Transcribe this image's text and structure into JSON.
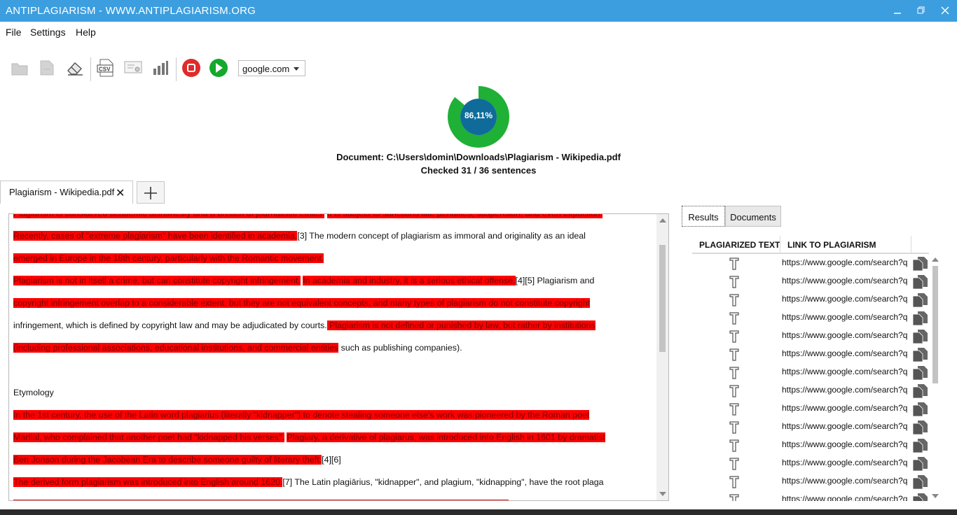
{
  "window": {
    "title": "ANTIPLAGIARISM - WWW.ANTIPLAGIARISM.ORG"
  },
  "menu": {
    "items": [
      "File",
      "Settings",
      "Help"
    ]
  },
  "toolbar": {
    "buttons": [
      "open-folder",
      "save",
      "eraser",
      "export-csv",
      "certificate",
      "statistics",
      "stop",
      "start"
    ],
    "engine_value": "google.com"
  },
  "gauge": {
    "percent_label": "86,11%",
    "value": 0.8611,
    "colors": {
      "ring": "#1fb036",
      "center": "#0f6c9a"
    }
  },
  "document": {
    "line": "Document: C:\\Users\\domin\\Downloads\\Plagiarism - Wikipedia.pdf",
    "checked": "Checked 31 / 36 sentences"
  },
  "doc_tab": {
    "label": "Plagiarism - Wikipedia.pdf"
  },
  "text_lines": [
    {
      "segments": [
        {
          "t": "Plagiarism is considered academic dishonesty and a breach of journalistic ethics.",
          "hl": true
        },
        {
          "t": " ",
          "hl": false
        },
        {
          "t": "It is subject to sanctions like penalties, suspension, and even expulsion.",
          "hl": true
        }
      ]
    },
    {
      "segments": [
        {
          "t": "Recently, cases of \"extreme plagiarism\" have been identified in academia.",
          "hl": true
        },
        {
          "t": "[3] The modern concept of plagiarism as immoral and originality as an ideal",
          "hl": false
        }
      ]
    },
    {
      "segments": [
        {
          "t": "emerged in Europe in the 18th century, particularly with the Romantic movement.",
          "hl": true
        }
      ]
    },
    {
      "segments": [
        {
          "t": "Plagiarism is not in itself a crime, but can constitute copyright infringement.",
          "hl": true
        },
        {
          "t": " ",
          "hl": false
        },
        {
          "t": "In academia and industry, it is a serious ethical offense.",
          "hl": true
        },
        {
          "t": "[4][5] Plagiarism and",
          "hl": false
        }
      ]
    },
    {
      "segments": [
        {
          "t": "copyright infringement overlap to a considerable extent, but they are not equivalent concepts, and many types of plagiarism do not constitute copyright",
          "hl": true
        }
      ]
    },
    {
      "segments": [
        {
          "t": "infringement, which is defined by copyright law and may be adjudicated by courts.",
          "hl": false
        },
        {
          "t": " Plagiarism is not defined or punished by law, but rather by institutions",
          "hl": true
        }
      ]
    },
    {
      "segments": [
        {
          "t": "(including professional associations, educational institutions, and commercial entities",
          "hl": true
        },
        {
          "t": " such as publishing companies).",
          "hl": false
        }
      ]
    },
    {
      "segments": []
    },
    {
      "segments": [
        {
          "t": "Etymology",
          "hl": false
        }
      ]
    },
    {
      "segments": [
        {
          "t": "In the 1st century, the use of the Latin word plagiarius (literally \"kidnapper\") to denote stealing someone else's work was pioneered by the Roman poet",
          "hl": true
        }
      ]
    },
    {
      "segments": [
        {
          "t": "Martial, who complained that another poet had \"kidnapped his verses\".",
          "hl": true
        },
        {
          "t": " ",
          "hl": false
        },
        {
          "t": "Plagiary, a derivative of plagiarus, was introduced into English in 1601 by dramatist",
          "hl": true
        }
      ]
    },
    {
      "segments": [
        {
          "t": "Ben Jonson during the Jacobean Era to describe someone guilty of literary theft.",
          "hl": true
        },
        {
          "t": "[4][6]",
          "hl": false
        }
      ]
    },
    {
      "segments": [
        {
          "t": "The derived form plagiarism was introduced into English around 1620.",
          "hl": true
        },
        {
          "t": "[7] The Latin plagiārius, \"kidnapper\", and plagium, \"kidnapping\", have the root plaga",
          "hl": false
        }
      ]
    },
    {
      "segments": [
        {
          "t": "(\"snare\", \"net\"), based on the Indo-European root *-plak, \"to weave\" (seen for instance in Greek plekein, Bulgarian \"плета\" pleta).",
          "hl": true
        }
      ]
    }
  ],
  "results_tabs": {
    "results": "Results",
    "documents": "Documents"
  },
  "results_table": {
    "headers": [
      "PLAGIARIZED TEXT",
      "LINK TO PLAGIARISM"
    ],
    "rows": [
      "https://www.google.com/search?q",
      "https://www.google.com/search?q",
      "https://www.google.com/search?q",
      "https://www.google.com/search?q",
      "https://www.google.com/search?q",
      "https://www.google.com/search?q",
      "https://www.google.com/search?q",
      "https://www.google.com/search?q",
      "https://www.google.com/search?q",
      "https://www.google.com/search?q",
      "https://www.google.com/search?q",
      "https://www.google.com/search?q",
      "https://www.google.com/search?q",
      "https://www.google.com/search?q"
    ]
  },
  "colors": {
    "titlebar": "#3c9edf",
    "highlight": "#ff0000"
  }
}
